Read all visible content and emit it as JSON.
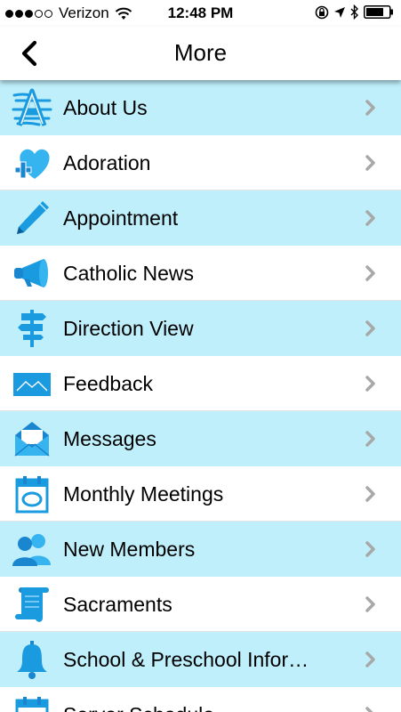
{
  "status_bar": {
    "carrier": "Verizon",
    "time": "12:48 PM",
    "signal_dots": [
      "full",
      "full",
      "full",
      "empty",
      "empty"
    ]
  },
  "header": {
    "title": "More",
    "back_icon": "chevron-left-icon"
  },
  "colors": {
    "row_tint": "#bfeffb",
    "icon_blue": "#1a9be0",
    "chevron": "#a8a8a8"
  },
  "menu": {
    "items": [
      {
        "label": "About Us",
        "icon": "letter-a-icon"
      },
      {
        "label": "Adoration",
        "icon": "heart-plus-icon"
      },
      {
        "label": "Appointment",
        "icon": "pencil-icon"
      },
      {
        "label": "Catholic News",
        "icon": "megaphone-icon"
      },
      {
        "label": "Direction View",
        "icon": "signpost-icon"
      },
      {
        "label": "Feedback",
        "icon": "envelope-icon"
      },
      {
        "label": "Messages",
        "icon": "open-envelope-icon"
      },
      {
        "label": "Monthly Meetings",
        "icon": "calendar-icon"
      },
      {
        "label": "New Members",
        "icon": "people-icon"
      },
      {
        "label": "Sacraments",
        "icon": "scroll-icon"
      },
      {
        "label": "School & Preschool Infor…",
        "icon": "bell-icon"
      },
      {
        "label": "Server Schedule",
        "icon": "calendar-grid-icon"
      }
    ]
  }
}
